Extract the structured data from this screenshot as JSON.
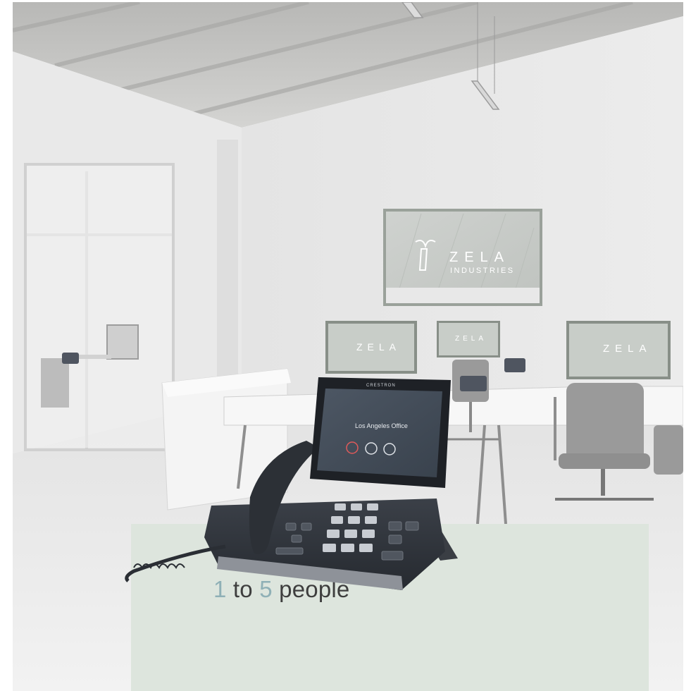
{
  "photo": {
    "brand_primary": "ZELA",
    "brand_secondary": "INDUSTRIES",
    "phone_brand": "CRESTRON",
    "screen_location": "Los Angeles Office"
  },
  "caption": {
    "min": "1",
    "to_text": " to ",
    "max": "5",
    "suffix": " people"
  },
  "colors": {
    "card_background": "#dde5dd",
    "number_accent": "#8fb0b6",
    "text": "#3e3e3e"
  }
}
